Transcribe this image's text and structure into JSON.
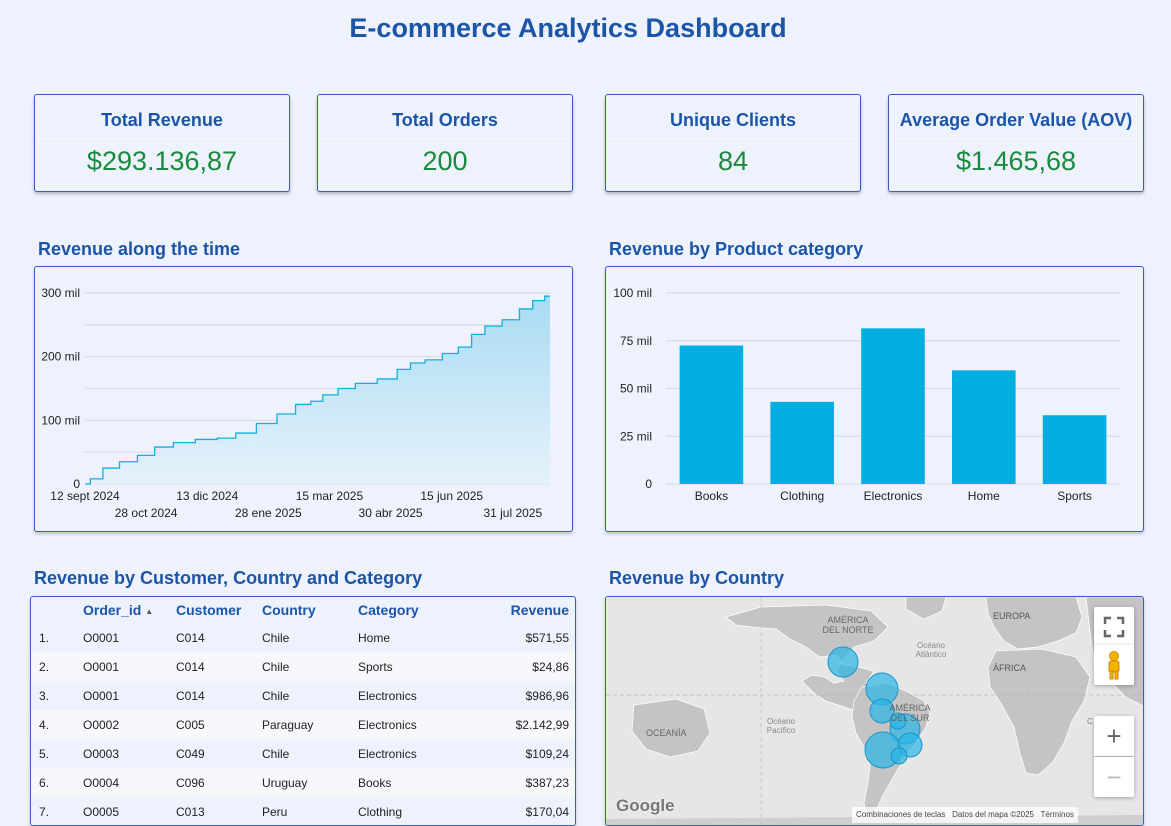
{
  "page_title": "E-commerce Analytics Dashboard",
  "kpis": [
    {
      "label": "Total Revenue",
      "value": "$293.136,87"
    },
    {
      "label": "Total Orders",
      "value": "200"
    },
    {
      "label": "Unique Clients",
      "value": "84"
    },
    {
      "label": "Average Order Value (AOV)",
      "value": "$1.465,68"
    }
  ],
  "sections": {
    "time": "Revenue along the time",
    "category": "Revenue by Product category",
    "table": "Revenue by Customer, Country and Category",
    "country": "Revenue by Country"
  },
  "colors": {
    "accent": "#1c55a8",
    "kpi_value": "#1a8a3c",
    "bar": "#00aee0",
    "area_line": "#16aede",
    "area_fill": "#bfe3f6",
    "bubble": "#29b6e8"
  },
  "chart_data": [
    {
      "type": "area",
      "title": "Revenue along the time",
      "x": [
        "2024-09-12",
        "2024-09-20",
        "2024-10-01",
        "2024-10-15",
        "2024-10-28",
        "2024-11-10",
        "2024-11-25",
        "2024-12-13",
        "2024-12-28",
        "2025-01-10",
        "2025-01-28",
        "2025-02-10",
        "2025-02-25",
        "2025-03-05",
        "2025-03-15",
        "2025-03-28",
        "2025-04-10",
        "2025-04-30",
        "2025-05-10",
        "2025-05-20",
        "2025-06-01",
        "2025-06-15",
        "2025-06-25",
        "2025-07-05",
        "2025-07-15",
        "2025-07-31",
        "2025-08-10",
        "2025-08-20",
        "2025-08-28"
      ],
      "y": [
        0,
        8000,
        25000,
        35000,
        45000,
        58000,
        65000,
        70000,
        72000,
        80000,
        95000,
        110000,
        125000,
        130000,
        140000,
        150000,
        158000,
        165000,
        180000,
        190000,
        195000,
        205000,
        215000,
        235000,
        248000,
        258000,
        275000,
        288000,
        295000
      ],
      "yticks": [
        "0",
        "100 mil",
        "200 mil",
        "300 mil"
      ],
      "xticks": [
        "12 sept 2024",
        "28 oct 2024",
        "13 dic 2024",
        "28 ene 2025",
        "15 mar 2025",
        "30 abr 2025",
        "15 jun 2025",
        "31 jul 2025"
      ],
      "ylim": [
        0,
        300000
      ],
      "grid": true
    },
    {
      "type": "bar",
      "title": "Revenue by Product category",
      "categories": [
        "Books",
        "Clothing",
        "Electronics",
        "Home",
        "Sports"
      ],
      "values": [
        72500,
        43000,
        81500,
        59500,
        36000
      ],
      "yticks": [
        "0",
        "25 mil",
        "50 mil",
        "75 mil",
        "100 mil"
      ],
      "ylim": [
        0,
        100000
      ],
      "grid": true
    }
  ],
  "table": {
    "headers": {
      "order_id": "Order_id",
      "sort_icon": "▲",
      "customer": "Customer",
      "country": "Country",
      "category": "Category",
      "revenue": "Revenue"
    },
    "rows": [
      {
        "idx": "1.",
        "order_id": "O0001",
        "customer": "C014",
        "country": "Chile",
        "category": "Home",
        "revenue": "$571,55"
      },
      {
        "idx": "2.",
        "order_id": "O0001",
        "customer": "C014",
        "country": "Chile",
        "category": "Sports",
        "revenue": "$24,86"
      },
      {
        "idx": "3.",
        "order_id": "O0001",
        "customer": "C014",
        "country": "Chile",
        "category": "Electronics",
        "revenue": "$986,96"
      },
      {
        "idx": "4.",
        "order_id": "O0002",
        "customer": "C005",
        "country": "Paraguay",
        "category": "Electronics",
        "revenue": "$2.142,99"
      },
      {
        "idx": "5.",
        "order_id": "O0003",
        "customer": "C049",
        "country": "Chile",
        "category": "Electronics",
        "revenue": "$109,24"
      },
      {
        "idx": "6.",
        "order_id": "O0004",
        "customer": "C096",
        "country": "Uruguay",
        "category": "Books",
        "revenue": "$387,23"
      },
      {
        "idx": "7.",
        "order_id": "O0005",
        "customer": "C013",
        "country": "Peru",
        "category": "Clothing",
        "revenue": "$170,04"
      }
    ]
  },
  "map": {
    "labels": {
      "north_america": "AMÉRICA DEL NORTE",
      "europe": "EUROPA",
      "africa": "ÁFRICA",
      "south_america": "AMÉRICA DEL SUR",
      "oceania": "OCEANÍA",
      "atlantic": "Océano Atlántico",
      "pacific": "Océano Pacífico"
    },
    "brand": "Google",
    "attribution": [
      "Combinaciones de teclas",
      "Datos del mapa ©2025",
      "Términos"
    ],
    "controls": {
      "fullscreen": "fullscreen-icon",
      "pegman": "pegman-icon",
      "zoom_in": "+",
      "zoom_out": "−"
    }
  }
}
